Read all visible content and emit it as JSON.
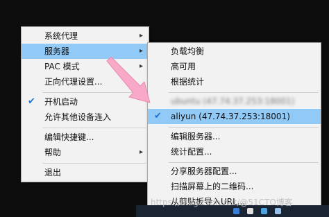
{
  "main_menu": {
    "system_proxy": "系统代理",
    "servers": "服务器",
    "pac_mode": "PAC 模式",
    "forward_proxy": "正向代理设置...",
    "startup": "开机启动",
    "allow_lan": "允许其他设备连入",
    "edit_hotkeys": "编辑快捷键...",
    "help": "帮助",
    "quit": "退出"
  },
  "server_menu": {
    "load_balance": "负载均衡",
    "high_availability": "高可用",
    "by_statistics": "根据统计",
    "hidden_server": "ubuntu (47.74.37.253:18001)",
    "aliyun_server": "aliyun (47.74.37.253:18001)",
    "edit_servers": "编辑服务器...",
    "statistics_config": "统计配置...",
    "share_config": "分享服务器配置...",
    "scan_qr": "扫描屏幕上的二维码...",
    "import_url": "从剪贴板导入URL..."
  },
  "watermark": "https://blog.csdn.net/@51CTO博客",
  "icons": {
    "submenu": "chevron-right-icon",
    "check": "check-icon",
    "pointer": "pink-arrow-icon"
  },
  "colors": {
    "highlight": "#91c9f7",
    "check": "#1e70c8",
    "menu_bg": "#f2f2f2",
    "annotation_arrow": "#f8a9c7"
  }
}
